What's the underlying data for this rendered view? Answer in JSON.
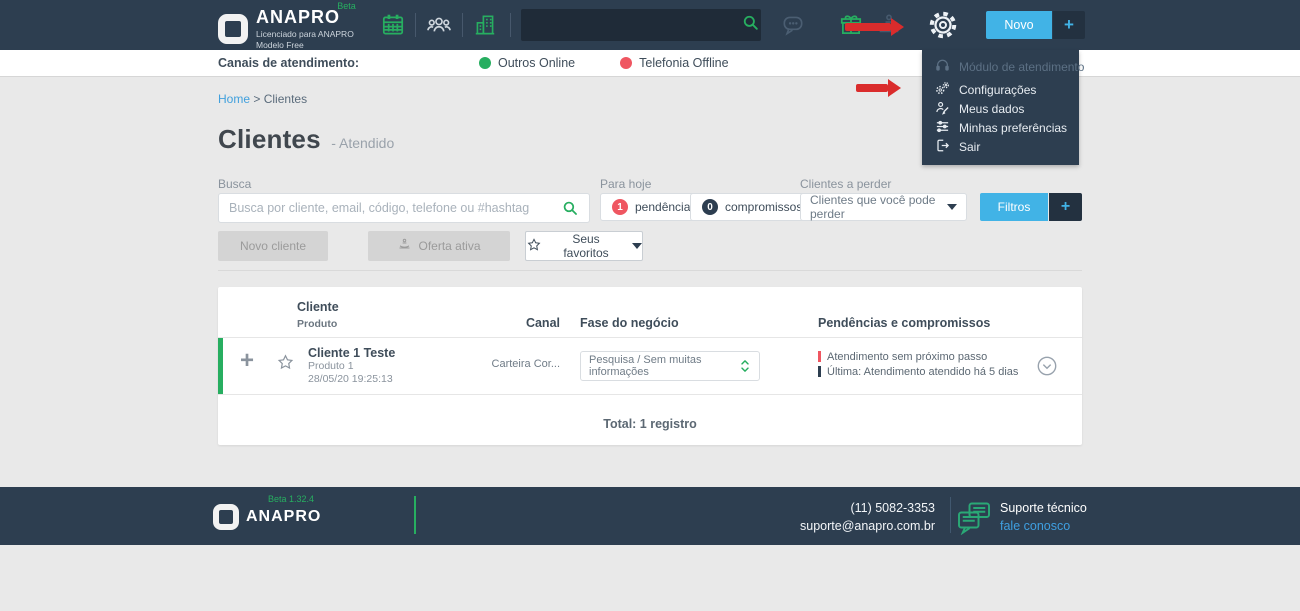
{
  "navbar": {
    "brand": "ANAPRO",
    "beta": "Beta",
    "license1": "Licenciado para ANAPRO",
    "license2": "Modelo Free",
    "novo": "Novo",
    "plus": "+"
  },
  "settings_menu": {
    "items": [
      {
        "label": "Módulo de atendimento",
        "disabled": true
      },
      {
        "label": "Configurações",
        "disabled": false
      },
      {
        "label": "Meus dados",
        "disabled": false
      },
      {
        "label": "Minhas preferências",
        "disabled": false
      },
      {
        "label": "Sair",
        "disabled": false
      }
    ]
  },
  "status_bar": {
    "label": "Canais de atendimento:",
    "channels": [
      {
        "label": "Outros Online",
        "color": "#27ae60"
      },
      {
        "label": "Telefonia Offline",
        "color": "#ef5661"
      }
    ]
  },
  "breadcrumb": {
    "home": "Home",
    "separator": ">",
    "current": "Clientes"
  },
  "page": {
    "title": "Clientes",
    "subtitle": "- Atendido"
  },
  "filters": {
    "busca_label": "Busca",
    "busca_placeholder": "Busca por cliente, email, código, telefone ou #hashtag",
    "para_hoje_label": "Para hoje",
    "pendencias_count": "1",
    "pendencias_label": "pendências",
    "compromissos_count": "0",
    "compromissos_label": "compromissos",
    "perder_label": "Clientes a perder",
    "perder_value": "Clientes que você pode perder",
    "filtros": "Filtros",
    "filtros_plus": "+",
    "novo_cliente": "Novo cliente",
    "oferta_ativa": "Oferta ativa",
    "seus_favoritos": "Seus favoritos"
  },
  "table": {
    "headers": {
      "cliente": "Cliente",
      "produto": "Produto",
      "canal": "Canal",
      "fase": "Fase do negócio",
      "pendencias": "Pendências e compromissos"
    },
    "rows": [
      {
        "cliente": "Cliente 1 Teste",
        "produto": "Produto 1",
        "datetime": "28/05/20 19:25:13",
        "canal": "Carteira Cor...",
        "fase": "Pesquisa / Sem muitas informações",
        "pendencias": [
          {
            "text": "Atendimento sem próximo passo",
            "color": "#ef5661"
          },
          {
            "text": "Última: Atendimento atendido há 5 dias",
            "color": "#2d3e50"
          }
        ]
      }
    ],
    "total": "Total: 1 registro"
  },
  "footer": {
    "beta": "Beta 1.32.4",
    "brand": "ANAPRO",
    "phone": "(11) 5082-3353",
    "email": "suporte@anapro.com.br",
    "support_title": "Suporte técnico",
    "support_link": "fale conosco"
  },
  "colors": {
    "navy": "#2d3e50",
    "green": "#27ae60",
    "blue": "#41b3e6",
    "red": "#ef5661",
    "arrow_red": "#da2c2c"
  }
}
